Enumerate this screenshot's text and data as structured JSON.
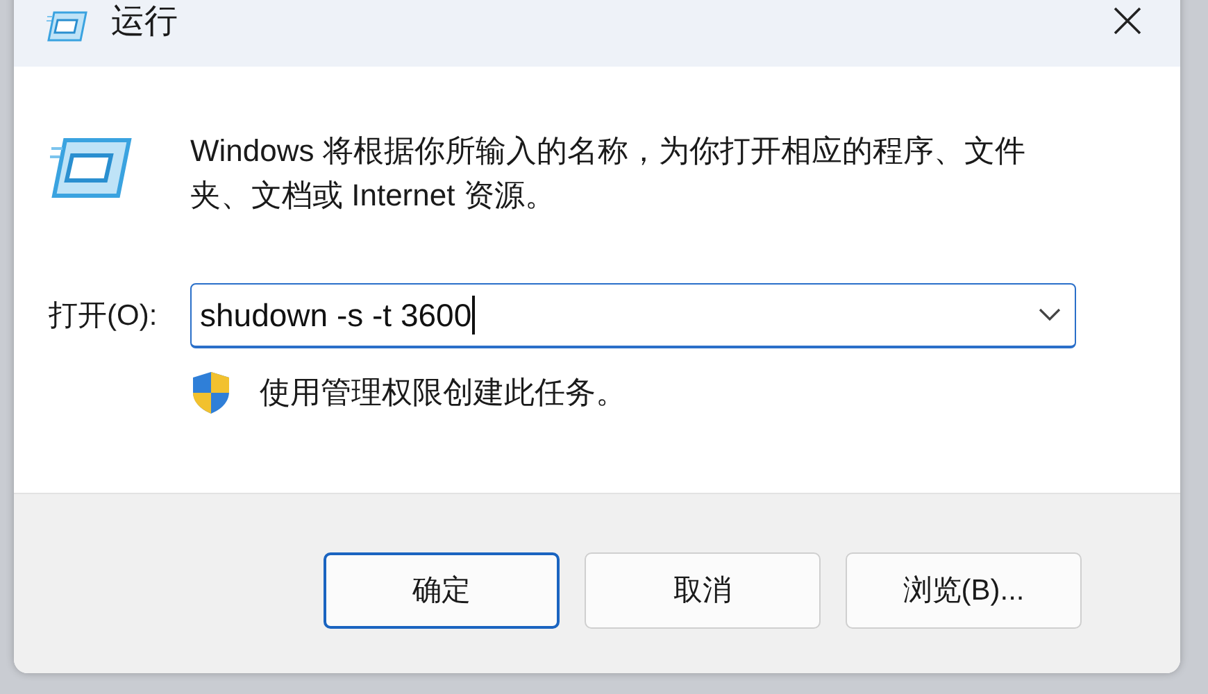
{
  "window": {
    "title": "运行"
  },
  "description": "Windows 将根据你所输入的名称，为你打开相应的程序、文件夹、文档或 Internet 资源。",
  "open_field": {
    "label": "打开(O):",
    "value": "shudown -s -t 3600",
    "focused": true
  },
  "admin_note": "使用管理权限创建此任务。",
  "buttons": [
    {
      "label": "确定",
      "selected": true
    },
    {
      "label": "取消",
      "selected": false
    },
    {
      "label": "浏览(B)...",
      "selected": false
    }
  ]
}
